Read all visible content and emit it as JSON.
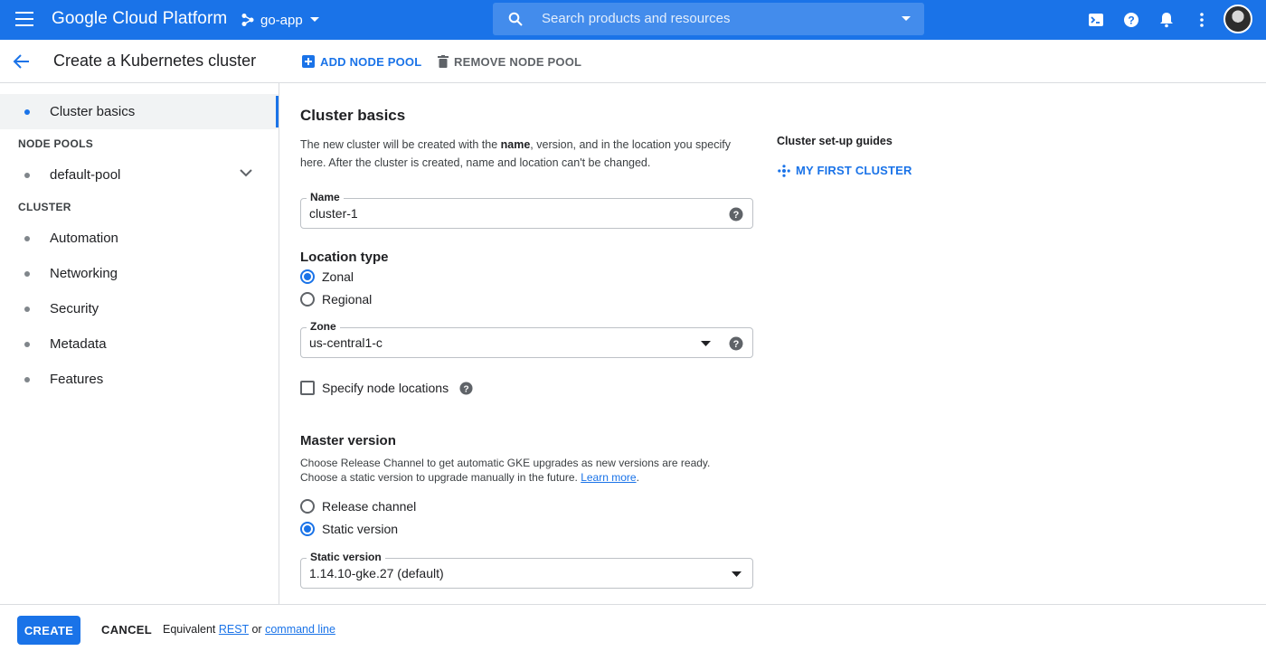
{
  "topbar": {
    "brand": "Google Cloud Platform",
    "project": "go-app",
    "search_placeholder": "Search products and resources"
  },
  "header": {
    "title": "Create a Kubernetes cluster",
    "add_node_pool": "ADD NODE POOL",
    "remove_node_pool": "REMOVE NODE POOL"
  },
  "sidebar": {
    "active_item": "Cluster basics",
    "node_pools_label": "NODE POOLS",
    "default_pool": "default-pool",
    "cluster_label": "CLUSTER",
    "cluster_items": [
      "Automation",
      "Networking",
      "Security",
      "Metadata",
      "Features"
    ]
  },
  "main": {
    "title": "Cluster basics",
    "desc_pre": "The new cluster will be created with the ",
    "desc_name": "name",
    "desc_mid": ", version, and in the location you specify here. After the cluster is created, name and location can't be changed.",
    "name_label": "Name",
    "name_value": "cluster-1",
    "location_type_title": "Location type",
    "location_zonal": "Zonal",
    "location_regional": "Regional",
    "selected_location_type": "Zonal",
    "zone_label": "Zone",
    "zone_value": "us-central1-c",
    "specify_node_locations": "Specify node locations",
    "specify_node_locations_checked": false,
    "master_version_title": "Master version",
    "master_desc": "Choose Release Channel to get automatic GKE upgrades as new versions are ready. Choose a static version to upgrade manually in the future. ",
    "learn_more": "Learn more",
    "release_channel": "Release channel",
    "static_version": "Static version",
    "selected_version_mode": "Static version",
    "static_version_label": "Static version",
    "static_version_value": "1.14.10-gke.27 (default)"
  },
  "guides": {
    "title": "Cluster set-up guides",
    "link": "MY FIRST CLUSTER"
  },
  "footer": {
    "create": "CREATE",
    "cancel": "CANCEL",
    "equiv_pre": "Equivalent",
    "rest": "REST",
    "or": "or",
    "command_line": "command line"
  },
  "colors": {
    "primary": "#1a73e8",
    "text": "#202124",
    "border": "#dadce0"
  }
}
